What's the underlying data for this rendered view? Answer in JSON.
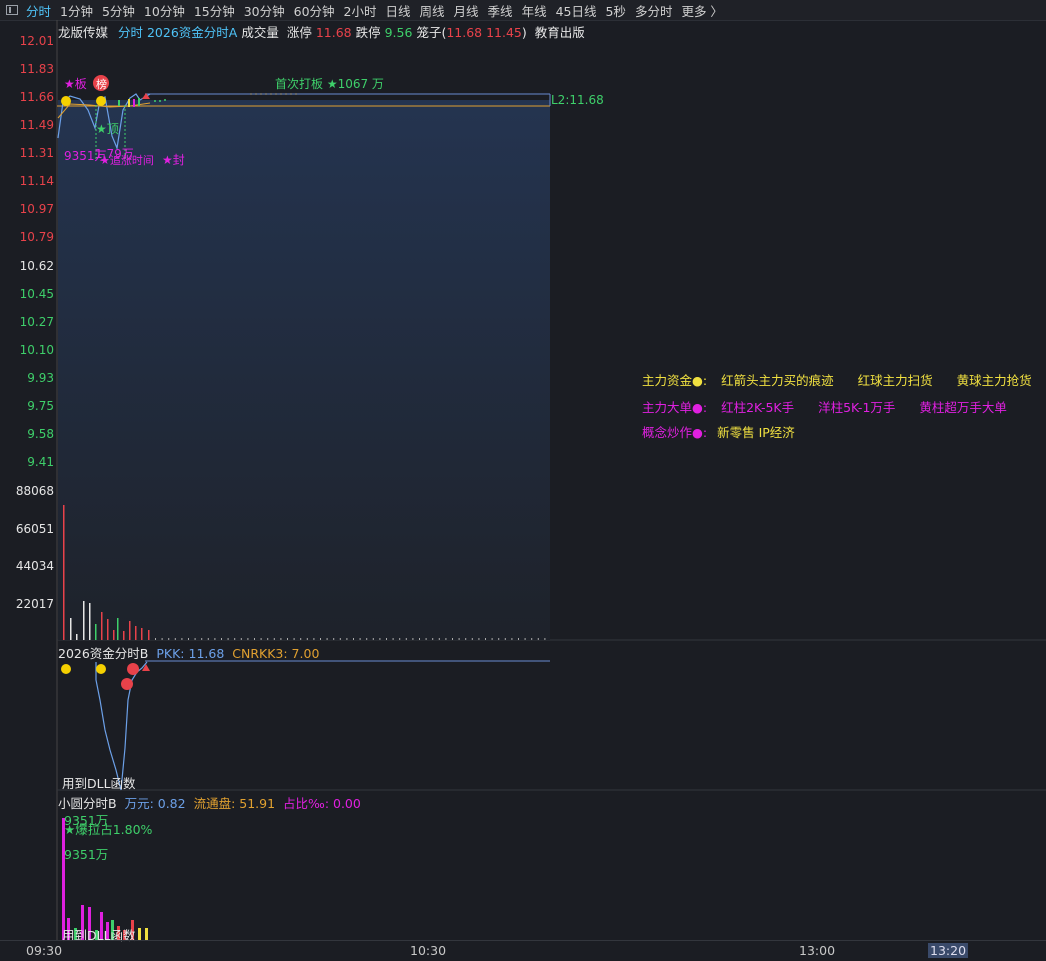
{
  "toolbar": {
    "timeframes": [
      "分时",
      "1分钟",
      "5分钟",
      "10分钟",
      "15分钟",
      "30分钟",
      "60分钟",
      "2小时",
      "日线",
      "周线",
      "月线",
      "季线",
      "年线",
      "45日线",
      "5秒",
      "多分时",
      "更多 〉"
    ],
    "active_index": 0
  },
  "main_header": {
    "name": "龙版传媒",
    "indicator": "分时 2026资金分时A",
    "volume_label": "成交量",
    "limit_up_label": "涨停",
    "limit_up_value": "11.68",
    "limit_down_label": "跌停",
    "limit_down_value": "9.56",
    "cage_label": "笼子(",
    "cage_values": "11.68 11.45",
    "cage_close": ")",
    "sector": "教育出版"
  },
  "price_axis": [
    "12.01",
    "11.83",
    "11.66",
    "11.49",
    "11.31",
    "11.14",
    "10.97",
    "10.79",
    "10.62",
    "10.45",
    "10.27",
    "10.10",
    "9.93",
    "9.75",
    "9.58",
    "9.41"
  ],
  "volume_axis": [
    "88068",
    "66051",
    "44034",
    "22017"
  ],
  "annotations": {
    "first_board": "首次打板 ★1067 万",
    "board_star": "★板",
    "badge": "榜",
    "ding": "★顶",
    "l_label": "L2:11.68",
    "amount": "9351万",
    "overlap_text": "1.79万",
    "chase_text": "★追涨时间",
    "seal_text": "★封"
  },
  "legend": {
    "row1_title": "主力资金●:",
    "row1_items": [
      "红箭头主力买的痕迹",
      "红球主力扫货",
      "黄球主力抢货"
    ],
    "row2_title": "主力大单●:",
    "row2_items": [
      "红柱2K-5K手",
      "洋柱5K-1万手",
      "黄柱超万手大单"
    ],
    "row3_title": "概念炒作●:",
    "row3_items": [
      "新零售 IP经济"
    ]
  },
  "sub1_header": {
    "name": "2026资金分时B",
    "pkk_label": "PKK: 11.68",
    "cnr_label": "CNRKK3: 7.00",
    "footer": "用到DLL函数"
  },
  "sub2_header": {
    "name": "小圆分时B",
    "wan_label": "万元: 0.82",
    "float_label": "流通盘: 51.91",
    "ratio_label": "占比‰: 0.00",
    "amount1": "9351万",
    "star_text": "★爆拉占1.80%",
    "amount2": "9351万",
    "footer": "用到DLL函数"
  },
  "time_axis": [
    "09:30",
    "10:30",
    "13:00",
    "13:20"
  ],
  "colors": {
    "up": "#e8424a",
    "down": "#3ecf6a",
    "accent": "#4fc3f7",
    "magenta": "#e020e0",
    "yellow": "#f0e040"
  }
}
